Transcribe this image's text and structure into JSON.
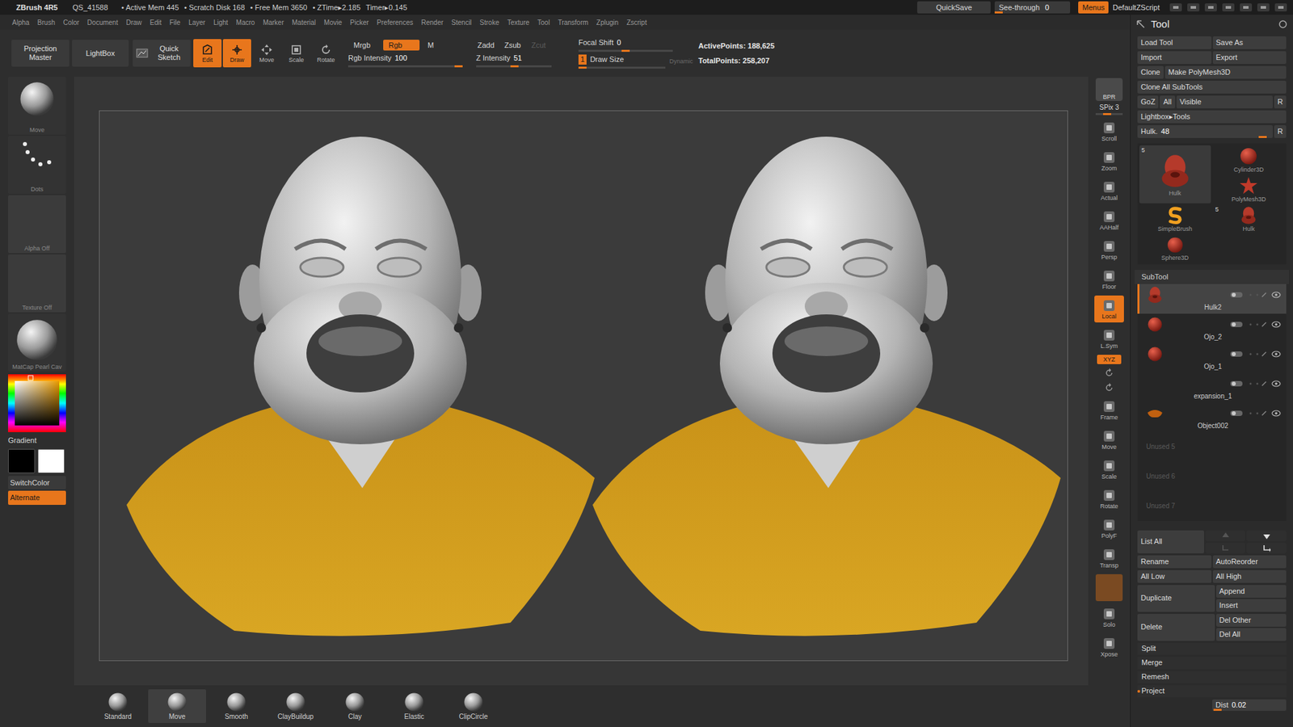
{
  "title_bar": {
    "app": "ZBrush 4R5",
    "file": "QS_41588",
    "stats": [
      "• Active Mem 445",
      "• Scratch Disk 168",
      "• Free Mem 3650",
      "• ZTime▸2.185",
      "Timer▸0.145"
    ],
    "quicksave": "QuickSave",
    "see_through": {
      "label": "See-through",
      "value": "0",
      "level": 0
    },
    "menus": {
      "label": "Menus",
      "selected": true
    },
    "script": "DefaultZScript"
  },
  "menu_bar": [
    "Alpha",
    "Brush",
    "Color",
    "Document",
    "Draw",
    "Edit",
    "File",
    "Layer",
    "Light",
    "Macro",
    "Marker",
    "Material",
    "Movie",
    "Picker",
    "Preferences",
    "Render",
    "Stencil",
    "Stroke",
    "Texture",
    "Tool",
    "Transform",
    "Zplugin",
    "Zscript"
  ],
  "top_shelf": {
    "projection_master": "Projection Master",
    "lightbox": "LightBox",
    "quick_sketch": "Quick Sketch",
    "modes": [
      {
        "label": "Edit",
        "selected": true
      },
      {
        "label": "Draw",
        "selected": true
      },
      {
        "label": "Move",
        "selected": false
      },
      {
        "label": "Scale",
        "selected": false
      },
      {
        "label": "Rotate",
        "selected": false
      }
    ],
    "color_modes": [
      {
        "label": "Mrgb",
        "selected": false
      },
      {
        "label": "Rgb",
        "selected": true
      },
      {
        "label": "M",
        "selected": false
      }
    ],
    "rgb_intensity": {
      "label": "Rgb Intensity",
      "value": "100",
      "level": 1
    },
    "z_modes": [
      {
        "label": "Zadd",
        "selected": false,
        "disabled": false
      },
      {
        "label": "Zsub",
        "selected": false,
        "disabled": false
      },
      {
        "label": "Zcut",
        "selected": false,
        "disabled": true
      }
    ],
    "z_intensity": {
      "label": "Z Intensity",
      "value": "51",
      "level": 0.51
    },
    "focal_shift": {
      "label": "Focal Shift",
      "value": "0",
      "level": 0.5
    },
    "draw_size": {
      "label": "Draw Size",
      "value": "1",
      "level": 0
    },
    "dynamic": {
      "label": "Dynamic",
      "selected": false
    },
    "active_points": "ActivePoints: 188,625",
    "total_points": "TotalPoints: 258,207"
  },
  "left_panel": {
    "items": [
      {
        "label": "Move",
        "kind": "brush"
      },
      {
        "label": "Dots",
        "kind": "stroke"
      },
      {
        "label": "Alpha Off",
        "kind": "empty"
      },
      {
        "label": "Texture Off",
        "kind": "empty"
      },
      {
        "label": "MatCap Pearl Cav",
        "kind": "material"
      }
    ],
    "gradient": "Gradient",
    "swatches": [
      {
        "color": "#000000"
      },
      {
        "color": "#ffffff"
      }
    ],
    "switch_color": "SwitchColor",
    "alternate": {
      "label": "Alternate",
      "selected": true
    }
  },
  "right_shelf": [
    {
      "label": "BPR",
      "kind": "render",
      "selected": false
    },
    {
      "label": "SPix 3",
      "kind": "slider",
      "selected": false,
      "level": 0.4
    },
    {
      "label": "Scroll",
      "kind": "button",
      "selected": false
    },
    {
      "label": "Zoom",
      "kind": "button",
      "selected": false
    },
    {
      "label": "Actual",
      "kind": "button",
      "selected": false
    },
    {
      "label": "AAHalf",
      "kind": "button",
      "selected": false
    },
    {
      "label": "Persp",
      "kind": "button",
      "selected": false
    },
    {
      "label": "Floor",
      "kind": "button",
      "selected": false
    },
    {
      "label": "Local",
      "kind": "button",
      "selected": true
    },
    {
      "label": "L.Sym",
      "kind": "button",
      "selected": false
    },
    {
      "label": "XYZ",
      "kind": "small",
      "selected": true
    },
    {
      "kind": "icon",
      "selected": false
    },
    {
      "kind": "icon",
      "selected": false
    },
    {
      "label": "Frame",
      "kind": "button",
      "selected": false
    },
    {
      "label": "Move",
      "kind": "button",
      "selected": false
    },
    {
      "label": "Scale",
      "kind": "button",
      "selected": false
    },
    {
      "label": "Rotate",
      "kind": "button",
      "selected": false
    },
    {
      "label": "PolyF",
      "kind": "button",
      "selected": false
    },
    {
      "label": "Transp",
      "kind": "button",
      "selected": false
    },
    {
      "kind": "ghost",
      "selected": false
    },
    {
      "label": "Solo",
      "kind": "button",
      "selected": false
    },
    {
      "label": "Xpose",
      "kind": "button",
      "selected": false
    }
  ],
  "bottom_shelf": [
    {
      "label": "Standard",
      "selected": false
    },
    {
      "label": "Move",
      "selected": true
    },
    {
      "label": "Smooth",
      "selected": false
    },
    {
      "label": "ClayBuildup",
      "selected": false
    },
    {
      "label": "Clay",
      "selected": false
    },
    {
      "label": "Elastic",
      "selected": false
    },
    {
      "label": "ClipCircle",
      "selected": false
    }
  ],
  "tool_panel": {
    "title": "Tool",
    "button_rows": [
      [
        "Load Tool",
        "Save As"
      ],
      [
        "Import",
        "Export"
      ],
      [
        "Clone",
        "Make PolyMesh3D"
      ],
      [
        "Clone All SubTools"
      ],
      [
        "GoZ",
        "All",
        "Visible",
        "R"
      ],
      [
        "Lightbox▸Tools"
      ]
    ],
    "tool_slider": {
      "label": "Hulk.",
      "value": "48",
      "level": 0.95
    },
    "tool_slider_reset": "R",
    "tools": [
      {
        "name": "Hulk",
        "count": "5",
        "kind": "head-large"
      },
      {
        "name": "Cylinder3D",
        "kind": "cylinder"
      },
      {
        "name": "PolyMesh3D",
        "kind": "polymesh"
      },
      {
        "name": "SimpleBrush",
        "kind": "simplebrush"
      },
      {
        "name": "Hulk",
        "count": "5",
        "kind": "head"
      },
      {
        "name": "Sphere3D",
        "kind": "sphere"
      }
    ],
    "subtool": {
      "title": "SubTool",
      "items": [
        {
          "name": "Hulk2",
          "kind": "head",
          "selected": true,
          "disabled": false
        },
        {
          "name": "Ojo_2",
          "kind": "sphere",
          "selected": false,
          "disabled": false
        },
        {
          "name": "Ojo_1",
          "kind": "sphere",
          "selected": false,
          "disabled": false
        },
        {
          "name": "expansion_1",
          "kind": "blank",
          "selected": false,
          "disabled": false
        },
        {
          "name": "Object002",
          "kind": "blob",
          "selected": false,
          "disabled": false
        },
        {
          "name": "Unused 5",
          "kind": "empty",
          "selected": false,
          "disabled": true
        },
        {
          "name": "Unused 6",
          "kind": "empty",
          "selected": false,
          "disabled": true
        },
        {
          "name": "Unused 7",
          "kind": "empty",
          "selected": false,
          "disabled": true
        }
      ],
      "list_all": "List All",
      "rows": [
        [
          "Rename",
          "AutoReorder"
        ],
        [
          "All Low",
          "All High"
        ]
      ],
      "pairs": [
        {
          "main": "Duplicate",
          "side": [
            "Append",
            "Insert"
          ]
        },
        {
          "main": "Delete",
          "side": [
            "Del Other",
            "Del All"
          ]
        }
      ],
      "sections": [
        {
          "label": "Split",
          "expanded": false
        },
        {
          "label": "Merge",
          "expanded": false
        },
        {
          "label": "Remesh",
          "expanded": false
        },
        {
          "label": "Project",
          "expanded": true
        }
      ],
      "dist": {
        "label": "Dist",
        "value": "0.02",
        "level": 0.02
      }
    }
  }
}
